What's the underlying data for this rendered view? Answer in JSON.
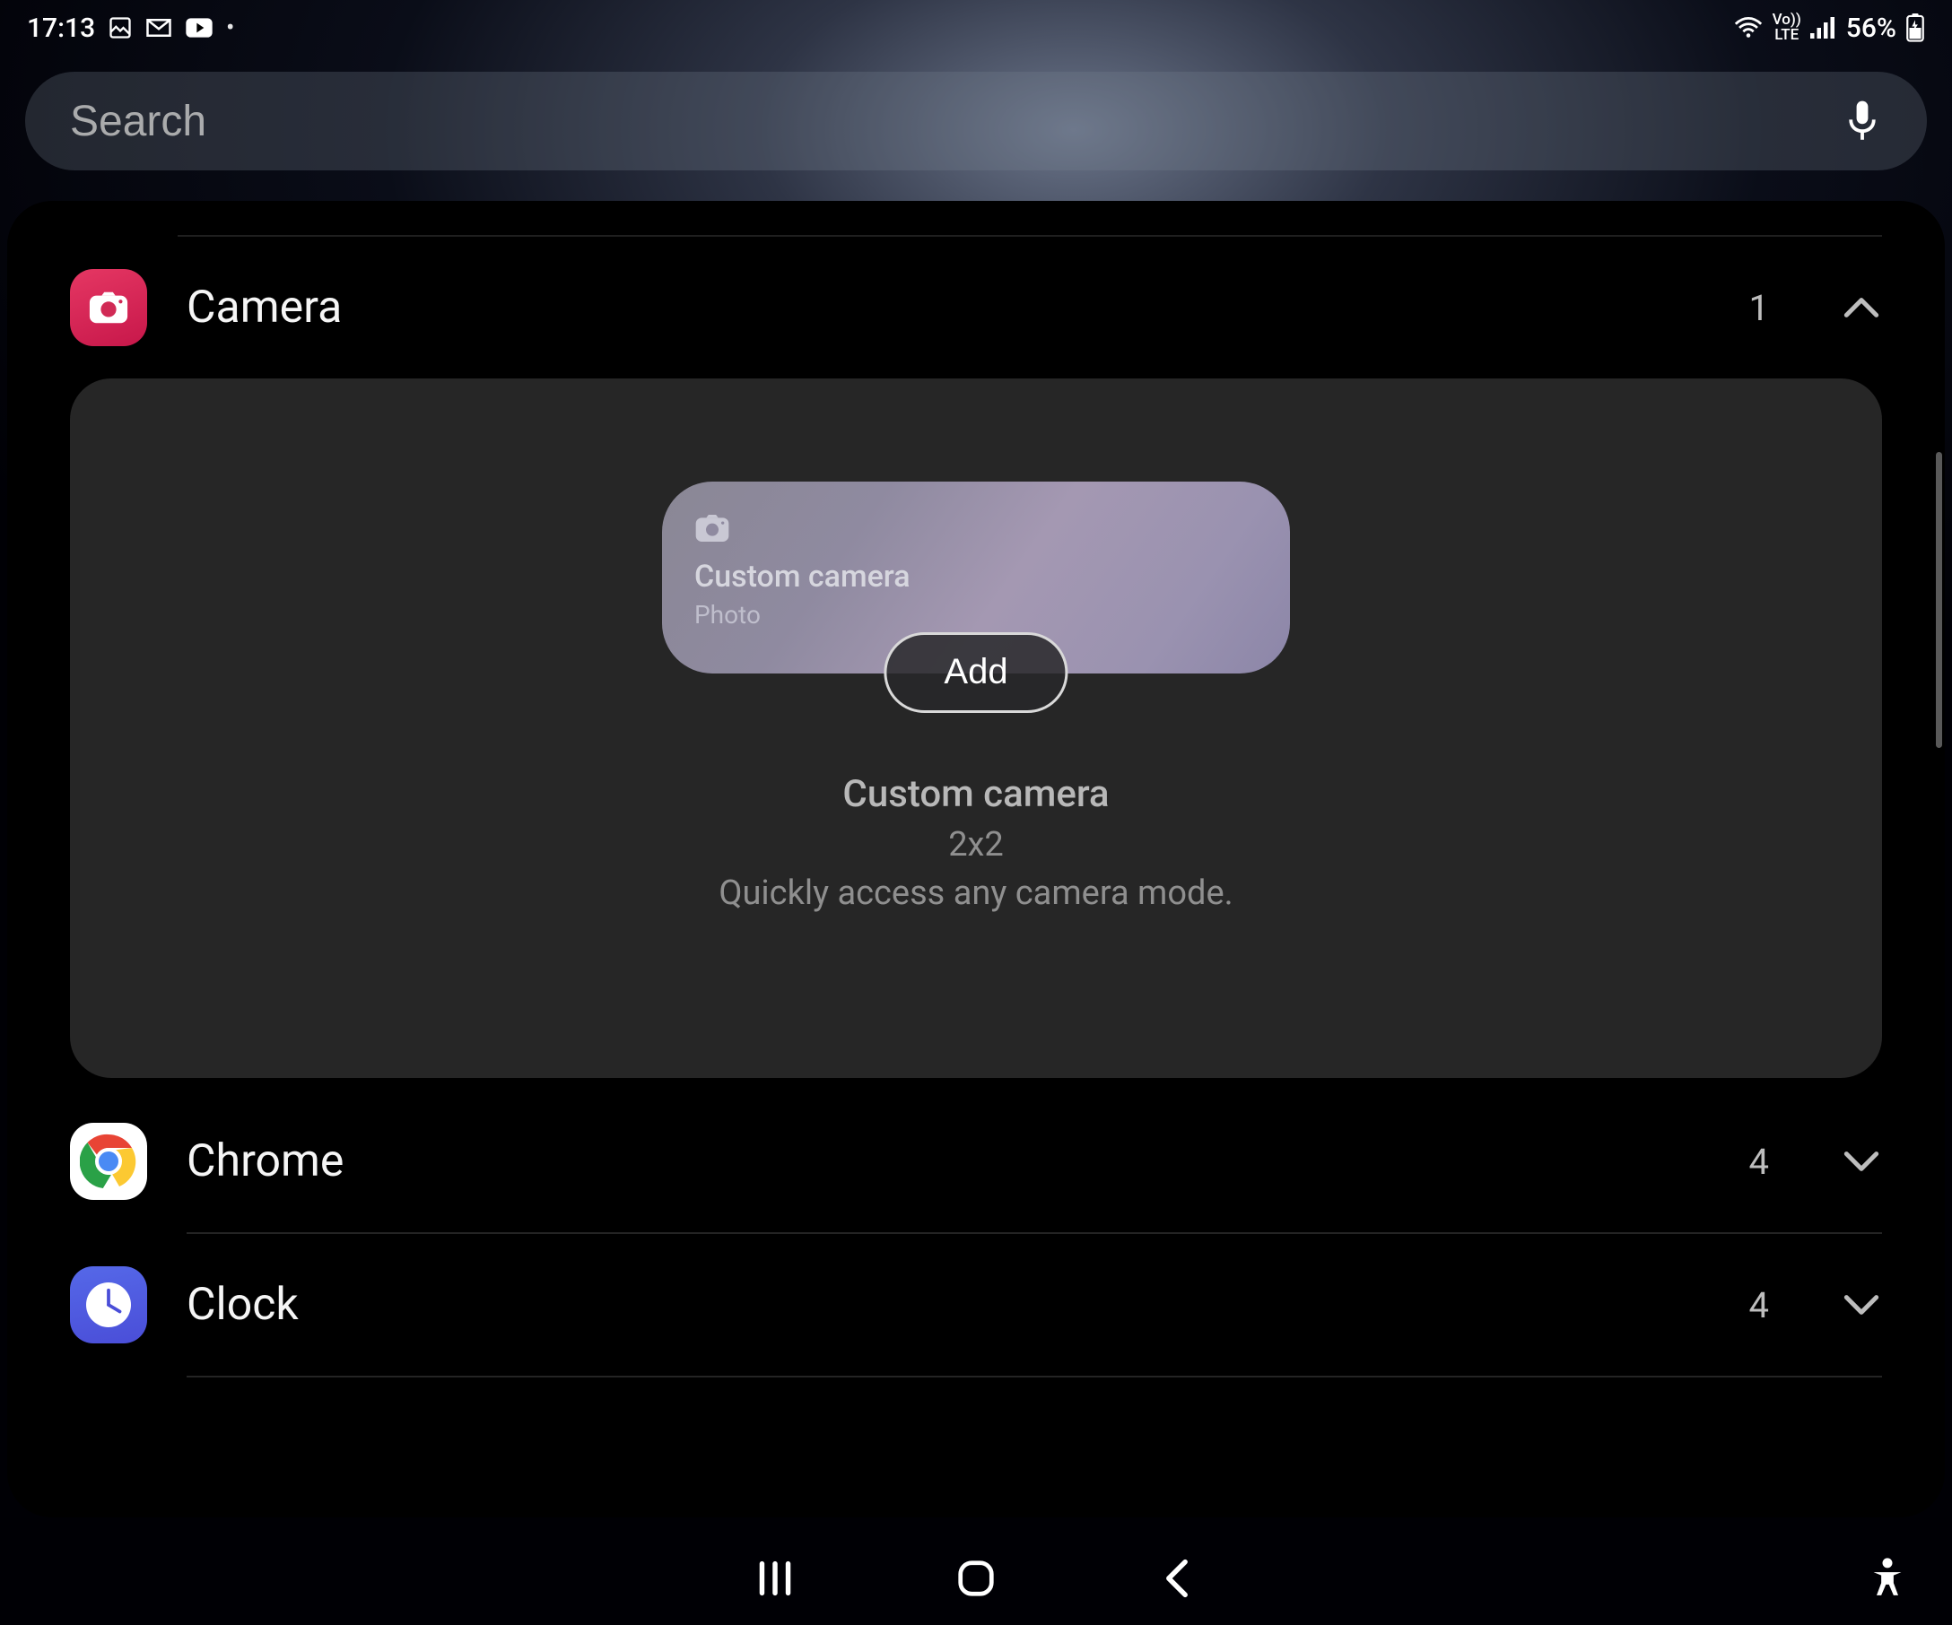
{
  "status": {
    "time": "17:13",
    "volte_top": "Vo))",
    "volte_bot": "LTE",
    "battery_text": "56%"
  },
  "search": {
    "placeholder": "Search"
  },
  "apps": [
    {
      "name": "Camera",
      "count": "1",
      "expanded": true
    },
    {
      "name": "Chrome",
      "count": "4",
      "expanded": false
    },
    {
      "name": "Clock",
      "count": "4",
      "expanded": false
    }
  ],
  "widget": {
    "preview_title": "Custom camera",
    "preview_sub": "Photo",
    "add_label": "Add",
    "meta_title": "Custom camera",
    "meta_dim": "2x2",
    "meta_desc": "Quickly access any camera mode."
  }
}
